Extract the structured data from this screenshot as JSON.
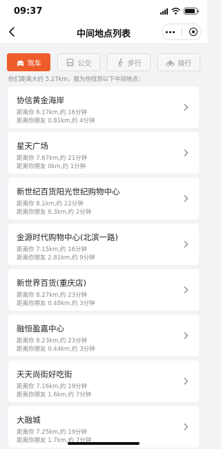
{
  "status": {
    "time": "09:37"
  },
  "nav": {
    "title": "中间地点列表"
  },
  "modes": [
    {
      "label": "驾车",
      "icon": "car-icon",
      "active": true
    },
    {
      "label": "公交",
      "icon": "bus-icon",
      "active": false
    },
    {
      "label": "步行",
      "icon": "walk-icon",
      "active": false
    },
    {
      "label": "骑行",
      "icon": "bike-icon",
      "active": false
    }
  ],
  "summary": "你们距离大约 5.27km，我为你找到以下中间地点：",
  "places": [
    {
      "name": "协信黄金海岸",
      "line1": "距离你 6.17km,约 16分钟",
      "line2": "距离你朋友 0.81km,约 4分钟"
    },
    {
      "name": "星天广场",
      "line1": "距离你 7.67km,约 21分钟",
      "line2": "距离你朋友 0km,约 1分钟"
    },
    {
      "name": "新世纪百货阳光世纪购物中心",
      "line1": "距离你 8.1km,约 22分钟",
      "line2": "距离你朋友 0.3km,约 2分钟"
    },
    {
      "name": "金源时代购物中心(北滨一路)",
      "line1": "距离你 7.15km,约 16分钟",
      "line2": "距离你朋友 2.81km,约 9分钟"
    },
    {
      "name": "新世界百货(重庆店)",
      "line1": "距离你 8.27km,约 23分钟",
      "line2": "距离你朋友 0.48km,约 3分钟"
    },
    {
      "name": "融恒盈嘉中心",
      "line1": "距离你 8.23km,约 23分钟",
      "line2": "距离你朋友 0.44km,约 3分钟"
    },
    {
      "name": "天天尚街好吃街",
      "line1": "距离你 7.16km,约 19分钟",
      "line2": "距离你朋友 1.6km,约 7分钟"
    },
    {
      "name": "大融城",
      "line1": "距离你 7.25km,约 19分钟",
      "line2": "距离你朋友 1.7km,约 7分钟"
    }
  ],
  "colors": {
    "accent": "#ee5d2c",
    "background": "#f2f3f5"
  }
}
